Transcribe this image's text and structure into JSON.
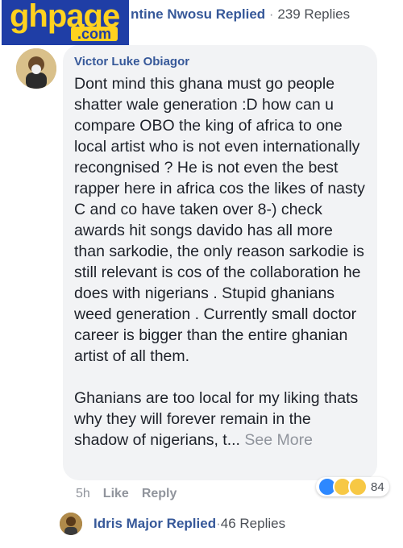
{
  "logo": {
    "main": "ghpage",
    "sub": ".com"
  },
  "top_reply": {
    "name": "ntine Nwosu Replied",
    "separator": "·",
    "count": "239 Replies"
  },
  "comment": {
    "author": "Victor Luke Obiagor",
    "paragraph1": "Dont mind this ghana must go people shatter wale generation :D how can u compare OBO the king of africa to one local artist who is not even internationally recongnised ? He is not even the best rapper here in africa cos the likes of nasty C and co have taken over 8-) check awards hit songs davido has all more than sarkodie, the only reason sarkodie is still relevant is cos of the collaboration he does with nigerians . Stupid ghanians weed generation . Currently small doctor career is bigger than the entire ghanian artist of all them.",
    "paragraph2": "Ghanians are too local for my liking thats why they will forever remain in the shadow of nigerians, t...",
    "see_more": "See More",
    "time": "5h",
    "like": "Like",
    "reply": "Reply",
    "reaction_count": "84",
    "reaction_icons": [
      "like-icon",
      "haha-icon",
      "wow-icon"
    ]
  },
  "reply_thread": {
    "name": "Idris Major Replied",
    "separator": "·",
    "count": "46 Replies"
  }
}
